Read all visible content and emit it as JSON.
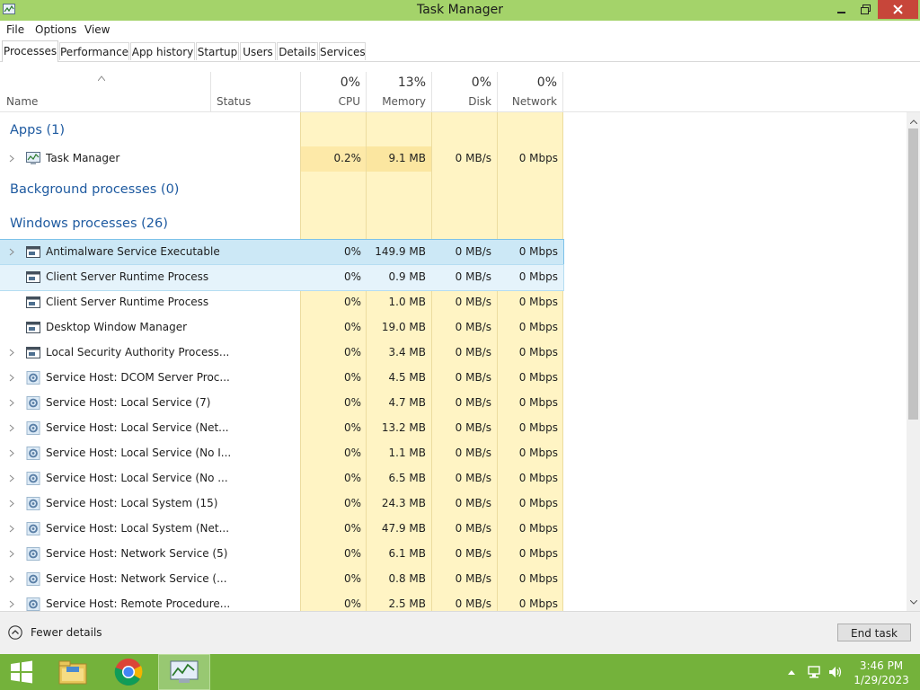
{
  "window": {
    "title": "Task Manager",
    "icons": {
      "app": "task-manager-icon",
      "minimize": "minimize-icon",
      "maximize": "restore-icon",
      "close": "close-icon"
    }
  },
  "menu": [
    "File",
    "Options",
    "View"
  ],
  "tabs": [
    {
      "label": "Processes",
      "active": true
    },
    {
      "label": "Performance"
    },
    {
      "label": "App history"
    },
    {
      "label": "Startup"
    },
    {
      "label": "Users"
    },
    {
      "label": "Details"
    },
    {
      "label": "Services"
    }
  ],
  "columns": {
    "name": "Name",
    "status": "Status",
    "cpu": {
      "pct": "0%",
      "label": "CPU"
    },
    "memory": {
      "pct": "13%",
      "label": "Memory"
    },
    "disk": {
      "pct": "0%",
      "label": "Disk"
    },
    "network": {
      "pct": "0%",
      "label": "Network"
    }
  },
  "groups": {
    "apps": "Apps (1)",
    "background": "Background processes (0)",
    "windows": "Windows processes (26)"
  },
  "apps": [
    {
      "name": "Task Manager",
      "cpu": "0.2%",
      "memory": "9.1 MB",
      "disk": "0 MB/s",
      "network": "0 Mbps",
      "icon": "task-manager-icon",
      "expandable": true
    }
  ],
  "windows_processes": [
    {
      "name": "Antimalware Service Executable",
      "cpu": "0%",
      "memory": "149.9 MB",
      "disk": "0 MB/s",
      "network": "0 Mbps",
      "icon": "window-icon",
      "expandable": true,
      "state": "selected"
    },
    {
      "name": "Client Server Runtime Process",
      "cpu": "0%",
      "memory": "0.9 MB",
      "disk": "0 MB/s",
      "network": "0 Mbps",
      "icon": "window-icon",
      "expandable": false,
      "state": "hover"
    },
    {
      "name": "Client Server Runtime Process",
      "cpu": "0%",
      "memory": "1.0 MB",
      "disk": "0 MB/s",
      "network": "0 Mbps",
      "icon": "window-icon",
      "expandable": false
    },
    {
      "name": "Desktop Window Manager",
      "cpu": "0%",
      "memory": "19.0 MB",
      "disk": "0 MB/s",
      "network": "0 Mbps",
      "icon": "window-icon",
      "expandable": false
    },
    {
      "name": "Local Security Authority Process...",
      "cpu": "0%",
      "memory": "3.4 MB",
      "disk": "0 MB/s",
      "network": "0 Mbps",
      "icon": "window-icon",
      "expandable": true
    },
    {
      "name": "Service Host: DCOM Server Proc...",
      "cpu": "0%",
      "memory": "4.5 MB",
      "disk": "0 MB/s",
      "network": "0 Mbps",
      "icon": "gear-icon",
      "expandable": true
    },
    {
      "name": "Service Host: Local Service (7)",
      "cpu": "0%",
      "memory": "4.7 MB",
      "disk": "0 MB/s",
      "network": "0 Mbps",
      "icon": "gear-icon",
      "expandable": true
    },
    {
      "name": "Service Host: Local Service (Net...",
      "cpu": "0%",
      "memory": "13.2 MB",
      "disk": "0 MB/s",
      "network": "0 Mbps",
      "icon": "gear-icon",
      "expandable": true
    },
    {
      "name": "Service Host: Local Service (No I...",
      "cpu": "0%",
      "memory": "1.1 MB",
      "disk": "0 MB/s",
      "network": "0 Mbps",
      "icon": "gear-icon",
      "expandable": true
    },
    {
      "name": "Service Host: Local Service (No ...",
      "cpu": "0%",
      "memory": "6.5 MB",
      "disk": "0 MB/s",
      "network": "0 Mbps",
      "icon": "gear-icon",
      "expandable": true
    },
    {
      "name": "Service Host: Local System (15)",
      "cpu": "0%",
      "memory": "24.3 MB",
      "disk": "0 MB/s",
      "network": "0 Mbps",
      "icon": "gear-icon",
      "expandable": true
    },
    {
      "name": "Service Host: Local System (Net...",
      "cpu": "0%",
      "memory": "47.9 MB",
      "disk": "0 MB/s",
      "network": "0 Mbps",
      "icon": "gear-icon",
      "expandable": true
    },
    {
      "name": "Service Host: Network Service (5)",
      "cpu": "0%",
      "memory": "6.1 MB",
      "disk": "0 MB/s",
      "network": "0 Mbps",
      "icon": "gear-icon",
      "expandable": true
    },
    {
      "name": "Service Host: Network Service (...",
      "cpu": "0%",
      "memory": "0.8 MB",
      "disk": "0 MB/s",
      "network": "0 Mbps",
      "icon": "gear-icon",
      "expandable": true
    },
    {
      "name": "Service Host: Remote Procedure...",
      "cpu": "0%",
      "memory": "2.5 MB",
      "disk": "0 MB/s",
      "network": "0 Mbps",
      "icon": "gear-icon",
      "expandable": true
    }
  ],
  "footer": {
    "fewer_details": "Fewer details",
    "end_task": "End task"
  },
  "taskbar": {
    "items": [
      "start-button",
      "file-explorer-icon",
      "chrome-icon",
      "task-manager-icon"
    ],
    "tray_icons": [
      "show-hidden-icons-arrow",
      "network-icon",
      "volume-icon"
    ],
    "time": "3:46 PM",
    "date": "1/29/2023"
  },
  "colors": {
    "titlebar": "#a4d36a",
    "taskbar": "#74b23b",
    "heat": "#fff4c4",
    "group_text": "#1e5aa0",
    "close": "#c7463a"
  }
}
